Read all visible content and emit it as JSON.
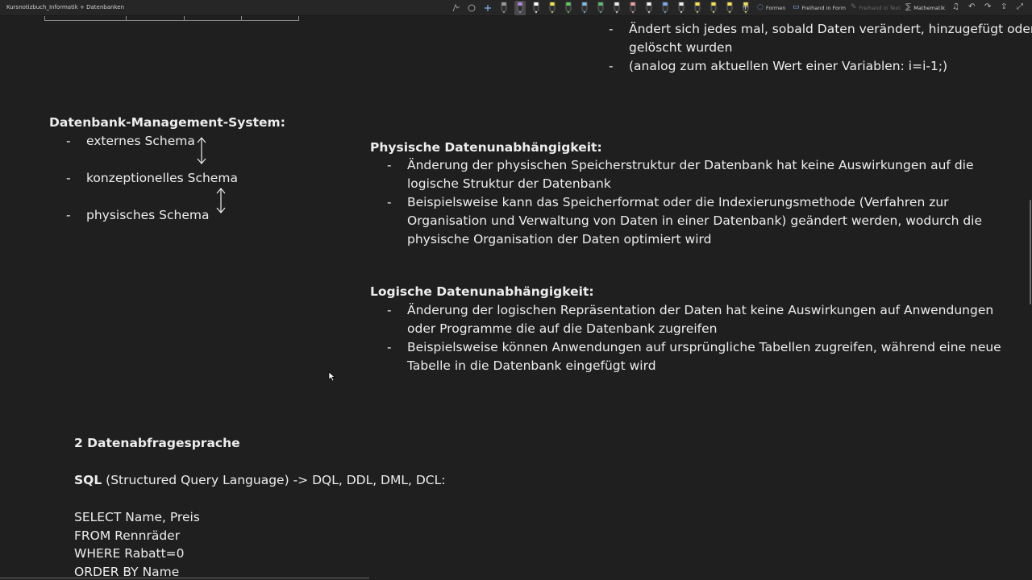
{
  "window": {
    "title": "Kursnotizbuch_Informatik + Datenbanken"
  },
  "toolbar": {
    "pen_colors": [
      "#9a9a9a",
      "#b084e0",
      "#ffffff",
      "#f2e84a",
      "#54d154",
      "#7dc0ee",
      "#5cc06a",
      "#ededed",
      "#f0a0a0",
      "#f3f3f3",
      "#6fb0ee",
      "#ededed",
      "#f2e84a",
      "#f2e84a",
      "#f2e84a",
      "#f2e84a"
    ],
    "formen": "Formen",
    "freihand_in_form": "Freihand in Form",
    "freihand_in_text": "Freihand in Text",
    "mathematik": "Mathematik"
  },
  "top_right_list": {
    "items": [
      {
        "lines": [
          "Ändert sich jedes mal, sobald Daten verändert, hinzugefügt oder",
          "gelöscht wurden"
        ]
      },
      {
        "lines": [
          "(analog zum aktuellen Wert einer Variablen: i=i-1;)"
        ]
      }
    ]
  },
  "dbms": {
    "heading": "Datenbank-Management-System:",
    "items": [
      "externes Schema",
      "konzeptionelles Schema",
      "physisches Schema"
    ]
  },
  "physical": {
    "heading": "Physische  Datenunabhängigkeit:",
    "items": [
      {
        "lines": [
          "Änderung der physischen Speicherstruktur der Datenbank hat keine Auswirkungen auf die",
          "logische Struktur der Datenbank"
        ]
      },
      {
        "lines": [
          "Beispielsweise kann das Speicherformat oder die Indexierungsmethode (Verfahren zur",
          "Organisation und Verwaltung von Daten in einer Datenbank) geändert werden, wodurch die",
          "physische Organisation der Daten optimiert wird"
        ]
      }
    ]
  },
  "logical": {
    "heading": "Logische Datenunabhängigkeit:",
    "items": [
      {
        "lines": [
          "Änderung der logischen Repräsentation der Daten hat keine Auswirkungen auf Anwendungen",
          "oder Programme die auf die Datenbank zugreifen"
        ]
      },
      {
        "lines": [
          "Beispielsweise können Anwendungen auf ursprüngliche Tabellen zugreifen, während eine neue",
          "Tabelle in die Datenbank eingefügt wird"
        ]
      }
    ]
  },
  "section2": {
    "heading": "2 Datenabfragesprache",
    "sql_bold": "SQL",
    "sql_rest": " (Structured Query Language) -> DQL, DDL, DML, DCL:",
    "query_lines": [
      "SELECT Name, Preis",
      "FROM Rennräder",
      "WHERE Rabatt=0",
      "ORDER BY Name"
    ]
  }
}
